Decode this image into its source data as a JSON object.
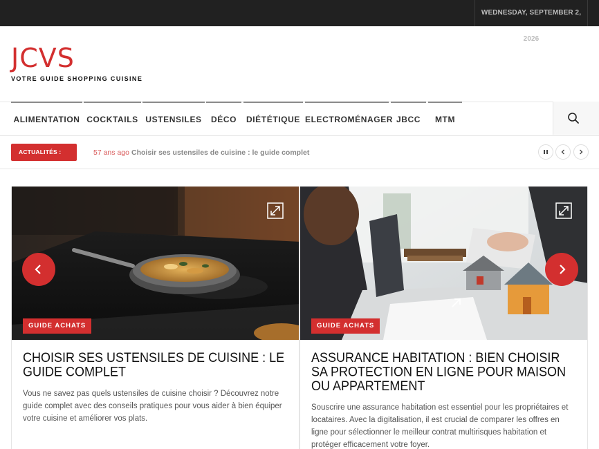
{
  "topbar": {
    "date": "WEDNESDAY, SEPTEMBER 2, 2026"
  },
  "site": {
    "name": "JCVS",
    "tagline": "VOTRE GUIDE SHOPPING CUISINE"
  },
  "nav": {
    "items": [
      "ALIMENTATION",
      "COCKTAILS",
      "USTENSILES",
      "DÉCO",
      "DIÉTÉTIQUE",
      "ELECTROMÉNAGER",
      "JBCC",
      "MTM"
    ],
    "search_icon": "search-icon"
  },
  "ticker": {
    "label": "ACTUALITÉS :",
    "time": "57 ans ago",
    "headline": "Choisir ses ustensiles de cuisine : le guide complet",
    "controls": [
      "pause-icon",
      "chevron-left-icon",
      "chevron-right-icon"
    ]
  },
  "slider": {
    "cards": [
      {
        "category": "GUIDE ACHATS",
        "title": "CHOISIR SES USTENSILES DE CUISINE : LE GUIDE COMPLET",
        "excerpt": "Vous ne savez pas quels ustensiles de cuisine choisir ? Découvrez notre guide complet avec des conseils pratiques pour vous aider à bien équiper votre cuisine et améliorer vos plats."
      },
      {
        "category": "GUIDE ACHATS",
        "title": "ASSURANCE HABITATION : BIEN CHOISIR SA PROTECTION EN LIGNE POUR MAISON OU APPARTEMENT",
        "excerpt": "Souscrire une assurance habitation est essentiel pour les propriétaires et locataires. Avec la digitalisation, il est crucial de comparer les offres en ligne pour sélectionner le meilleur contrat multirisques habitation et protéger efficacement votre foyer."
      }
    ]
  },
  "colors": {
    "accent": "#d32f2f",
    "topbar": "#212121"
  }
}
